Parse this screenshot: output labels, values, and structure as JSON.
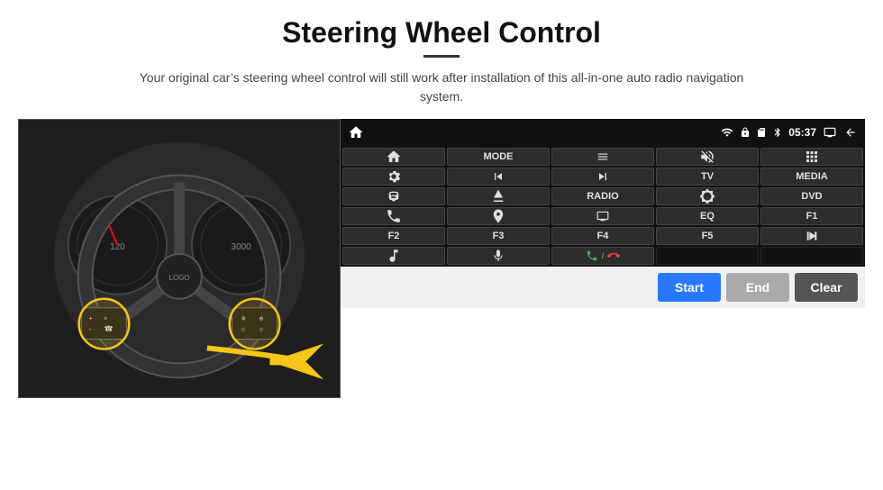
{
  "header": {
    "title": "Steering Wheel Control",
    "subtitle": "Your original car’s steering wheel control will still work after installation of this all-in-one auto radio navigation system."
  },
  "status_bar": {
    "time": "05:37",
    "wifi_icon": "wifi",
    "lock_icon": "lock",
    "sd_icon": "sd",
    "bluetooth_icon": "bluetooth",
    "screen_icon": "screen",
    "back_icon": "back"
  },
  "buttons": [
    {
      "id": "r1c1",
      "type": "icon",
      "label": "home"
    },
    {
      "id": "r1c2",
      "type": "text",
      "label": "MODE"
    },
    {
      "id": "r1c3",
      "type": "icon",
      "label": "list"
    },
    {
      "id": "r1c4",
      "type": "icon",
      "label": "mute"
    },
    {
      "id": "r1c5",
      "type": "icon",
      "label": "apps"
    },
    {
      "id": "r2c1",
      "type": "icon",
      "label": "settings"
    },
    {
      "id": "r2c2",
      "type": "icon",
      "label": "prev"
    },
    {
      "id": "r2c3",
      "type": "icon",
      "label": "next"
    },
    {
      "id": "r2c4",
      "type": "text",
      "label": "TV"
    },
    {
      "id": "r2c5",
      "type": "text",
      "label": "MEDIA"
    },
    {
      "id": "r3c1",
      "type": "icon",
      "label": "360cam"
    },
    {
      "id": "r3c2",
      "type": "icon",
      "label": "eject"
    },
    {
      "id": "r3c3",
      "type": "text",
      "label": "RADIO"
    },
    {
      "id": "r3c4",
      "type": "icon",
      "label": "brightness"
    },
    {
      "id": "r3c5",
      "type": "text",
      "label": "DVD"
    },
    {
      "id": "r4c1",
      "type": "icon",
      "label": "phone"
    },
    {
      "id": "r4c2",
      "type": "icon",
      "label": "navi"
    },
    {
      "id": "r4c3",
      "type": "icon",
      "label": "display"
    },
    {
      "id": "r4c4",
      "type": "text",
      "label": "EQ"
    },
    {
      "id": "r4c5",
      "type": "text",
      "label": "F1"
    },
    {
      "id": "r5c1",
      "type": "text",
      "label": "F2"
    },
    {
      "id": "r5c2",
      "type": "text",
      "label": "F3"
    },
    {
      "id": "r5c3",
      "type": "text",
      "label": "F4"
    },
    {
      "id": "r5c4",
      "type": "text",
      "label": "F5"
    },
    {
      "id": "r5c5",
      "type": "icon",
      "label": "playpause"
    },
    {
      "id": "r6c1",
      "type": "icon",
      "label": "music"
    },
    {
      "id": "r6c2",
      "type": "icon",
      "label": "mic"
    },
    {
      "id": "r6c3",
      "type": "icon",
      "label": "call"
    },
    {
      "id": "r6c4",
      "type": "empty",
      "label": ""
    },
    {
      "id": "r6c5",
      "type": "empty",
      "label": ""
    }
  ],
  "bottom_buttons": {
    "start": "Start",
    "end": "End",
    "clear": "Clear"
  }
}
